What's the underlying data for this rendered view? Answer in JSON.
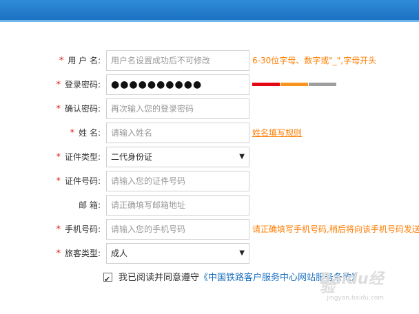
{
  "form": {
    "username": {
      "label": "用 户 名:",
      "placeholder": "用户名设置成功后不可修改",
      "hint": "6-30位字母、数字或\"_\",字母开头"
    },
    "password": {
      "label": "登录密码:",
      "value": "●●●●●●●●●●",
      "strength_colors": [
        "#e30613",
        "#f7931e",
        "#9e9e9e"
      ]
    },
    "confirm_password": {
      "label": "确认密码:",
      "placeholder": "再次输入您的登录密码"
    },
    "name": {
      "label": "姓 名:",
      "placeholder": "请输入姓名",
      "hint": "姓名填写规则"
    },
    "id_type": {
      "label": "证件类型:",
      "value": "二代身份证"
    },
    "id_number": {
      "label": "证件号码:",
      "placeholder": "请输入您的证件号码"
    },
    "email": {
      "label": "邮 箱:",
      "placeholder": "请正确填写邮箱地址"
    },
    "phone": {
      "label": "手机号码:",
      "placeholder": "请输入您的手机号码",
      "hint": "请正确填写手机号码,稍后将向该手机号码发送"
    },
    "passenger_type": {
      "label": "旅客类型:",
      "value": "成人"
    }
  },
  "required_mark": "*",
  "agreement": {
    "text": "我已阅读并同意遵守",
    "link": "《中国铁路客户服务中心网站服务条款》",
    "checked": true
  },
  "watermark": {
    "logo": "Baidu经验",
    "sub": "jingyan.baidu.com"
  }
}
